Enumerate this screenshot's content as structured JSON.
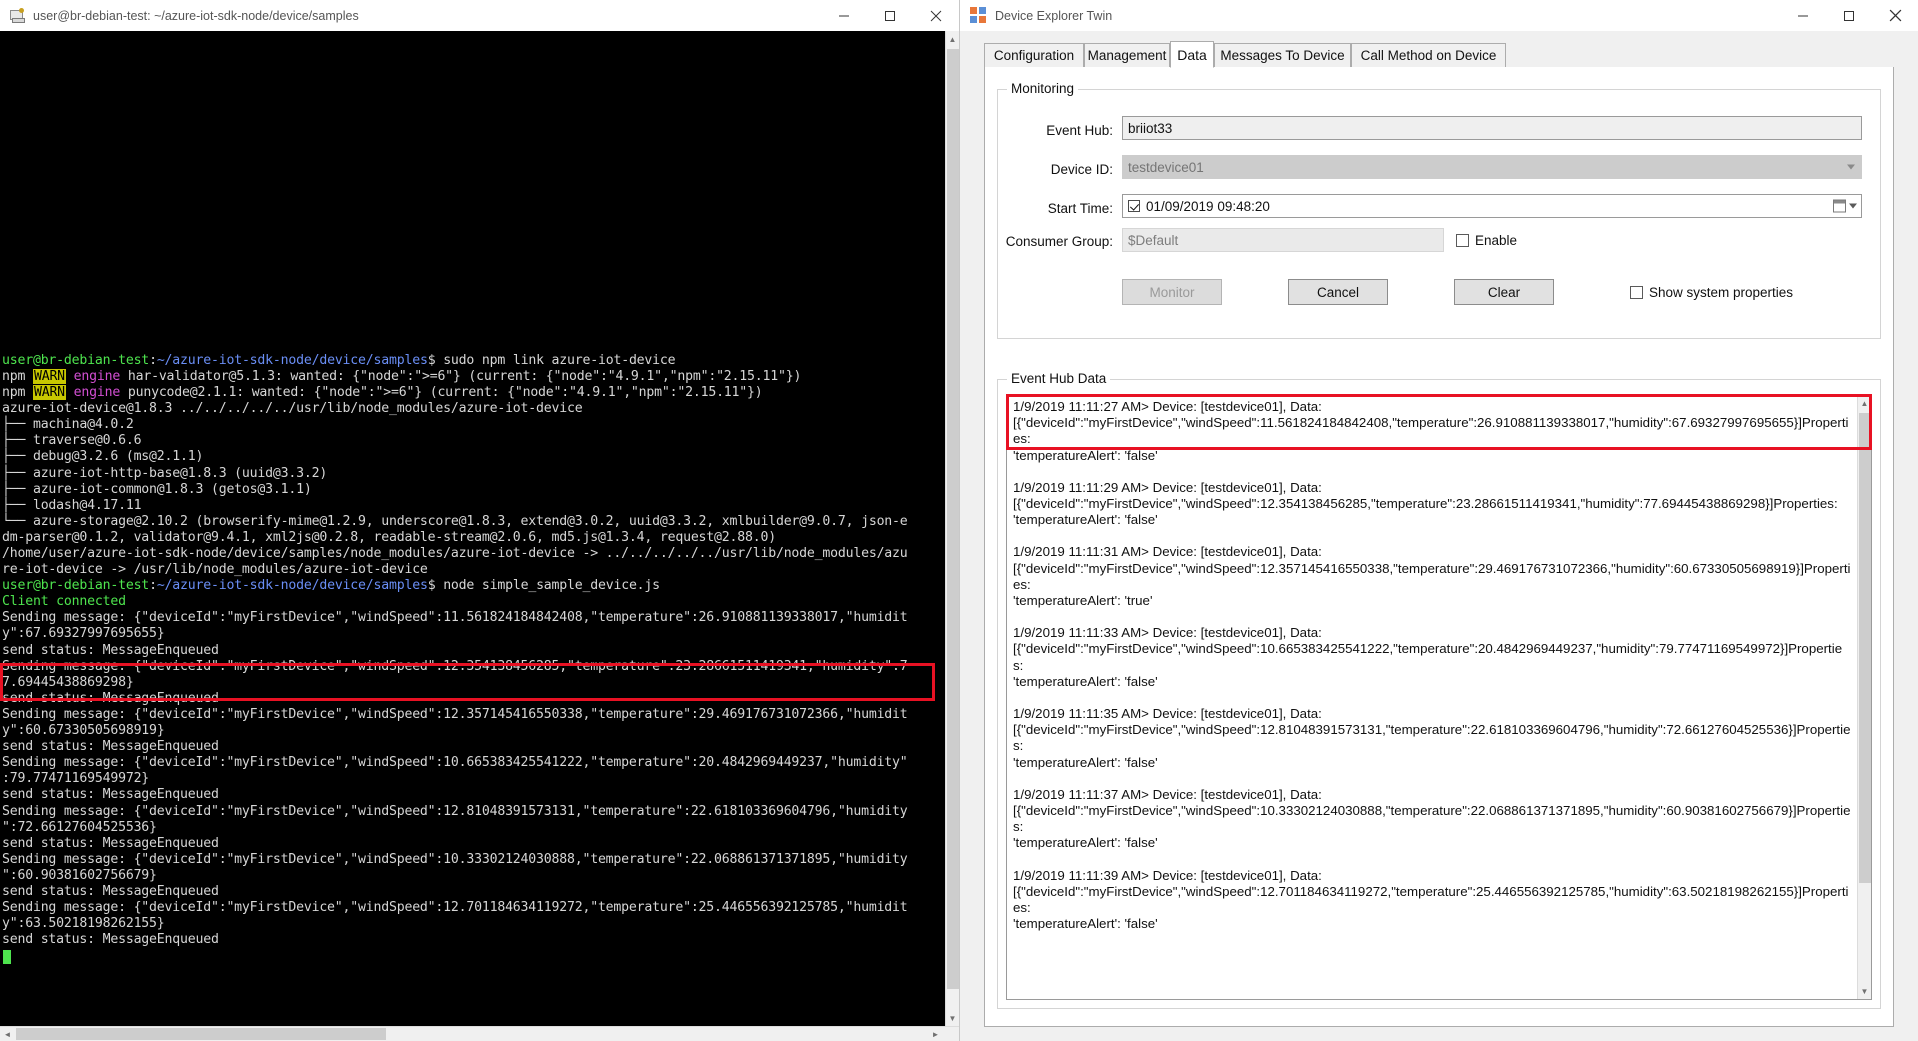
{
  "terminal": {
    "title": "user@br-debian-test: ~/azure-iot-sdk-node/device/samples",
    "icon": "terminal-icon",
    "window_controls": {
      "minimize": "–",
      "maximize": "□",
      "close": "✕"
    },
    "prompt_user": "user@br-debian-test",
    "prompt_path": ":~/azure-iot-sdk-node/device/samples",
    "prompt_symbol": "$",
    "commands": [
      "sudo npm link azure-iot-device",
      "node simple_sample_device.js"
    ],
    "lines": [
      {
        "type": "prompt",
        "user": "user@br-debian-test",
        "sep": ":",
        "path": "~/azure-iot-sdk-node/device/samples",
        "dollar": "$",
        "cmd": " sudo npm link azure-iot-device"
      },
      {
        "type": "warn",
        "pre": "npm ",
        "tag": "WARN",
        "mid": " engine ",
        "rest": "har-validator@5.1.3: wanted: {\"node\":\">=6\"} (current: {\"node\":\"4.9.1\",\"npm\":\"2.15.11\"})"
      },
      {
        "type": "warn",
        "pre": "npm ",
        "tag": "WARN",
        "mid": " engine ",
        "rest": "punycode@2.1.1: wanted: {\"node\":\">=6\"} (current: {\"node\":\"4.9.1\",\"npm\":\"2.15.11\"})"
      },
      {
        "type": "plain",
        "text": "azure-iot-device@1.8.3 ../../../../../usr/lib/node_modules/azure-iot-device"
      },
      {
        "type": "plain",
        "text": "├── machina@4.0.2"
      },
      {
        "type": "plain",
        "text": "├── traverse@0.6.6"
      },
      {
        "type": "plain",
        "text": "├── debug@3.2.6 (ms@2.1.1)"
      },
      {
        "type": "plain",
        "text": "├── azure-iot-http-base@1.8.3 (uuid@3.3.2)"
      },
      {
        "type": "plain",
        "text": "├── azure-iot-common@1.8.3 (getos@3.1.1)"
      },
      {
        "type": "plain",
        "text": "├── lodash@4.17.11"
      },
      {
        "type": "plain",
        "text": "└── azure-storage@2.10.2 (browserify-mime@1.2.9, underscore@1.8.3, extend@3.0.2, uuid@3.3.2, xmlbuilder@9.0.7, json-e"
      },
      {
        "type": "plain",
        "text": "dm-parser@0.1.2, validator@9.4.1, xml2js@0.2.8, readable-stream@2.0.6, md5.js@1.3.4, request@2.88.0)"
      },
      {
        "type": "plain",
        "text": "/home/user/azure-iot-sdk-node/device/samples/node_modules/azure-iot-device -> ../../../../../usr/lib/node_modules/azu"
      },
      {
        "type": "plain",
        "text": "re-iot-device -> /usr/lib/node_modules/azure-iot-device"
      },
      {
        "type": "prompt",
        "user": "user@br-debian-test",
        "sep": ":",
        "path": "~/azure-iot-sdk-node/device/samples",
        "dollar": "$",
        "cmd": " node simple_sample_device.js"
      },
      {
        "type": "green",
        "text": "Client connected"
      },
      {
        "type": "plain",
        "text": "Sending message: {\"deviceId\":\"myFirstDevice\",\"windSpeed\":11.561824184842408,\"temperature\":26.910881139338017,\"humidit"
      },
      {
        "type": "plain",
        "text": "y\":67.69327997695655}"
      },
      {
        "type": "plain",
        "text": "send status: MessageEnqueued"
      },
      {
        "type": "plain",
        "text": "Sending message: {\"deviceId\":\"myFirstDevice\",\"windSpeed\":12.354138456285,\"temperature\":23.28661511419341,\"humidity\":7"
      },
      {
        "type": "plain",
        "text": "7.69445438869298}"
      },
      {
        "type": "plain",
        "text": "send status: MessageEnqueued"
      },
      {
        "type": "plain",
        "text": "Sending message: {\"deviceId\":\"myFirstDevice\",\"windSpeed\":12.357145416550338,\"temperature\":29.469176731072366,\"humidit"
      },
      {
        "type": "plain",
        "text": "y\":60.67330505698919}"
      },
      {
        "type": "plain",
        "text": "send status: MessageEnqueued"
      },
      {
        "type": "plain",
        "text": "Sending message: {\"deviceId\":\"myFirstDevice\",\"windSpeed\":10.665383425541222,\"temperature\":20.4842969449237,\"humidity\""
      },
      {
        "type": "plain",
        "text": ":79.77471169549972}"
      },
      {
        "type": "plain",
        "text": "send status: MessageEnqueued"
      },
      {
        "type": "plain",
        "text": "Sending message: {\"deviceId\":\"myFirstDevice\",\"windSpeed\":12.81048391573131,\"temperature\":22.618103369604796,\"humidity"
      },
      {
        "type": "plain",
        "text": "\":72.66127604525536}"
      },
      {
        "type": "plain",
        "text": "send status: MessageEnqueued"
      },
      {
        "type": "plain",
        "text": "Sending message: {\"deviceId\":\"myFirstDevice\",\"windSpeed\":10.33302124030888,\"temperature\":22.068861371371895,\"humidity"
      },
      {
        "type": "plain",
        "text": "\":60.90381602756679}"
      },
      {
        "type": "plain",
        "text": "send status: MessageEnqueued"
      },
      {
        "type": "plain",
        "text": "Sending message: {\"deviceId\":\"myFirstDevice\",\"windSpeed\":12.701184634119272,\"temperature\":25.446556392125785,\"humidit"
      },
      {
        "type": "plain",
        "text": "y\":63.50218198262155}"
      },
      {
        "type": "plain",
        "text": "send status: MessageEnqueued"
      }
    ]
  },
  "device_explorer": {
    "title": "Device Explorer Twin",
    "icon": "device-explorer-icon",
    "window_controls": {
      "minimize": "–",
      "maximize": "□",
      "close": "✕"
    },
    "tabs": [
      {
        "label": "Configuration",
        "active": false
      },
      {
        "label": "Management",
        "active": false
      },
      {
        "label": "Data",
        "active": true
      },
      {
        "label": "Messages To Device",
        "active": false
      },
      {
        "label": "Call Method on Device",
        "active": false
      }
    ],
    "monitoring": {
      "legend": "Monitoring",
      "event_hub": {
        "label": "Event Hub:",
        "value": "briiot33"
      },
      "device_id": {
        "label": "Device ID:",
        "value": "testdevice01"
      },
      "start_time": {
        "label": "Start Time:",
        "value": "01/09/2019 09:48:20",
        "checked": true
      },
      "consumer_group": {
        "label": "Consumer Group:",
        "value": "$Default",
        "enable_label": "Enable",
        "enable_checked": false
      },
      "buttons": {
        "monitor": "Monitor",
        "cancel": "Cancel",
        "clear": "Clear"
      },
      "show_system_properties": {
        "label": "Show system properties",
        "checked": false
      }
    },
    "event_hub_data": {
      "legend": "Event Hub Data",
      "entries": [
        {
          "header": "1/9/2019 11:11:27 AM> Device: [testdevice01], Data:",
          "body": "[{\"deviceId\":\"myFirstDevice\",\"windSpeed\":11.561824184842408,\"temperature\":26.910881139338017,\"humidity\":67.69327997695655}]Properties:",
          "props": "'temperatureAlert': 'false'",
          "highlighted": true
        },
        {
          "header": "1/9/2019 11:11:29 AM> Device: [testdevice01], Data:",
          "body": "[{\"deviceId\":\"myFirstDevice\",\"windSpeed\":12.354138456285,\"temperature\":23.28661511419341,\"humidity\":77.69445438869298}]Properties:",
          "props": "'temperatureAlert': 'false'",
          "highlighted": false
        },
        {
          "header": "1/9/2019 11:11:31 AM> Device: [testdevice01], Data:",
          "body": "[{\"deviceId\":\"myFirstDevice\",\"windSpeed\":12.357145416550338,\"temperature\":29.469176731072366,\"humidity\":60.67330505698919}]Properties:",
          "props": "'temperatureAlert': 'true'",
          "highlighted": false
        },
        {
          "header": "1/9/2019 11:11:33 AM> Device: [testdevice01], Data:",
          "body": "[{\"deviceId\":\"myFirstDevice\",\"windSpeed\":10.665383425541222,\"temperature\":20.4842969449237,\"humidity\":79.77471169549972}]Properties:",
          "props": "'temperatureAlert': 'false'",
          "highlighted": false
        },
        {
          "header": "1/9/2019 11:11:35 AM> Device: [testdevice01], Data:",
          "body": "[{\"deviceId\":\"myFirstDevice\",\"windSpeed\":12.81048391573131,\"temperature\":22.618103369604796,\"humidity\":72.66127604525536}]Properties:",
          "props": "'temperatureAlert': 'false'",
          "highlighted": false
        },
        {
          "header": "1/9/2019 11:11:37 AM> Device: [testdevice01], Data:",
          "body": "[{\"deviceId\":\"myFirstDevice\",\"windSpeed\":10.33302124030888,\"temperature\":22.068861371371895,\"humidity\":60.90381602756679}]Properties:",
          "props": "'temperatureAlert': 'false'",
          "highlighted": false
        },
        {
          "header": "1/9/2019 11:11:39 AM> Device: [testdevice01], Data:",
          "body": "[{\"deviceId\":\"myFirstDevice\",\"windSpeed\":12.701184634119272,\"temperature\":25.446556392125785,\"humidity\":63.50218198262155}]Properties:",
          "props": "'temperatureAlert': 'false'",
          "highlighted": false
        }
      ]
    }
  },
  "colors": {
    "highlight_red": "#e81123",
    "terminal_bg": "#000000",
    "terminal_green": "#4ee44e",
    "terminal_blue": "#6a8ef5",
    "warn_bg": "#c8c800",
    "window_bg": "#f0f0f0"
  }
}
